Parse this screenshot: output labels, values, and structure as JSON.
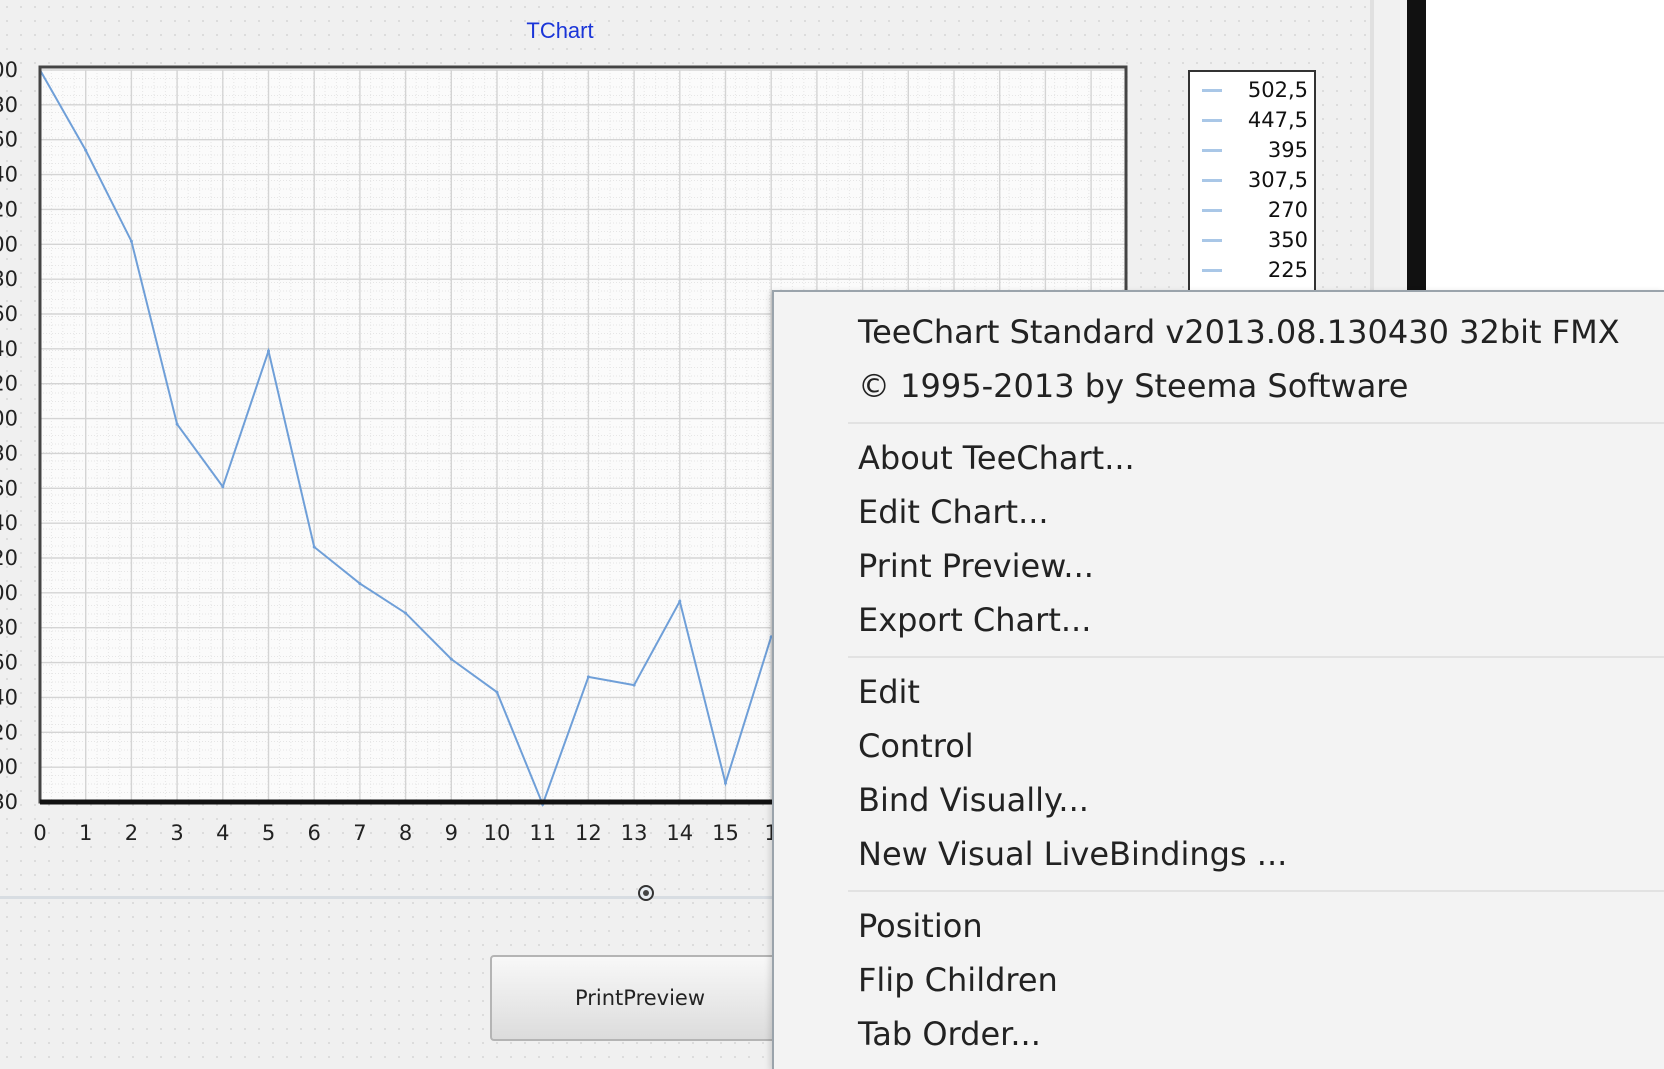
{
  "chart": {
    "title": "TChart",
    "y_tick_labels_visible": [
      "00",
      "80",
      "60",
      "40",
      "20",
      "00",
      "80",
      "60",
      "40",
      "20",
      "00",
      "80",
      "60",
      "40",
      "20",
      "00",
      "80",
      "60",
      "40",
      "20",
      "00",
      "80"
    ],
    "x_tick_labels": [
      "0",
      "1",
      "2",
      "3",
      "4",
      "5",
      "6",
      "7",
      "8",
      "9",
      "10",
      "11",
      "12",
      "13",
      "14",
      "15",
      "1"
    ]
  },
  "chart_data": {
    "type": "line",
    "title": "TChart",
    "xlabel": "",
    "ylabel": "",
    "x": [
      0,
      1,
      2,
      3,
      4,
      5,
      6,
      7,
      8,
      9,
      10,
      11,
      12,
      13,
      14,
      15,
      16
    ],
    "values": [
      600,
      532,
      455,
      300,
      247,
      362,
      196,
      165,
      140,
      101,
      73,
      -22,
      86,
      79,
      150,
      -4,
      120
    ],
    "ylim": [
      -20,
      600
    ],
    "xlim": [
      0,
      24
    ],
    "grid": true,
    "legend": "right",
    "series_color": "#6f9fd8"
  },
  "legend": {
    "items": [
      "502,5",
      "447,5",
      "395",
      "307,5",
      "270",
      "350",
      "225"
    ]
  },
  "form": {
    "print_button_label": "PrintPreview"
  },
  "context_menu": {
    "items": [
      "TeeChart Standard v2013.08.130430 32bit FMX",
      "© 1995-2013 by Steema Software",
      "About TeeChart...",
      "Edit Chart...",
      "Print Preview...",
      "Export Chart...",
      "Edit",
      "Control",
      "Bind Visually...",
      "New Visual LiveBindings ...",
      "Position",
      "Flip Children",
      "Tab Order..."
    ]
  }
}
